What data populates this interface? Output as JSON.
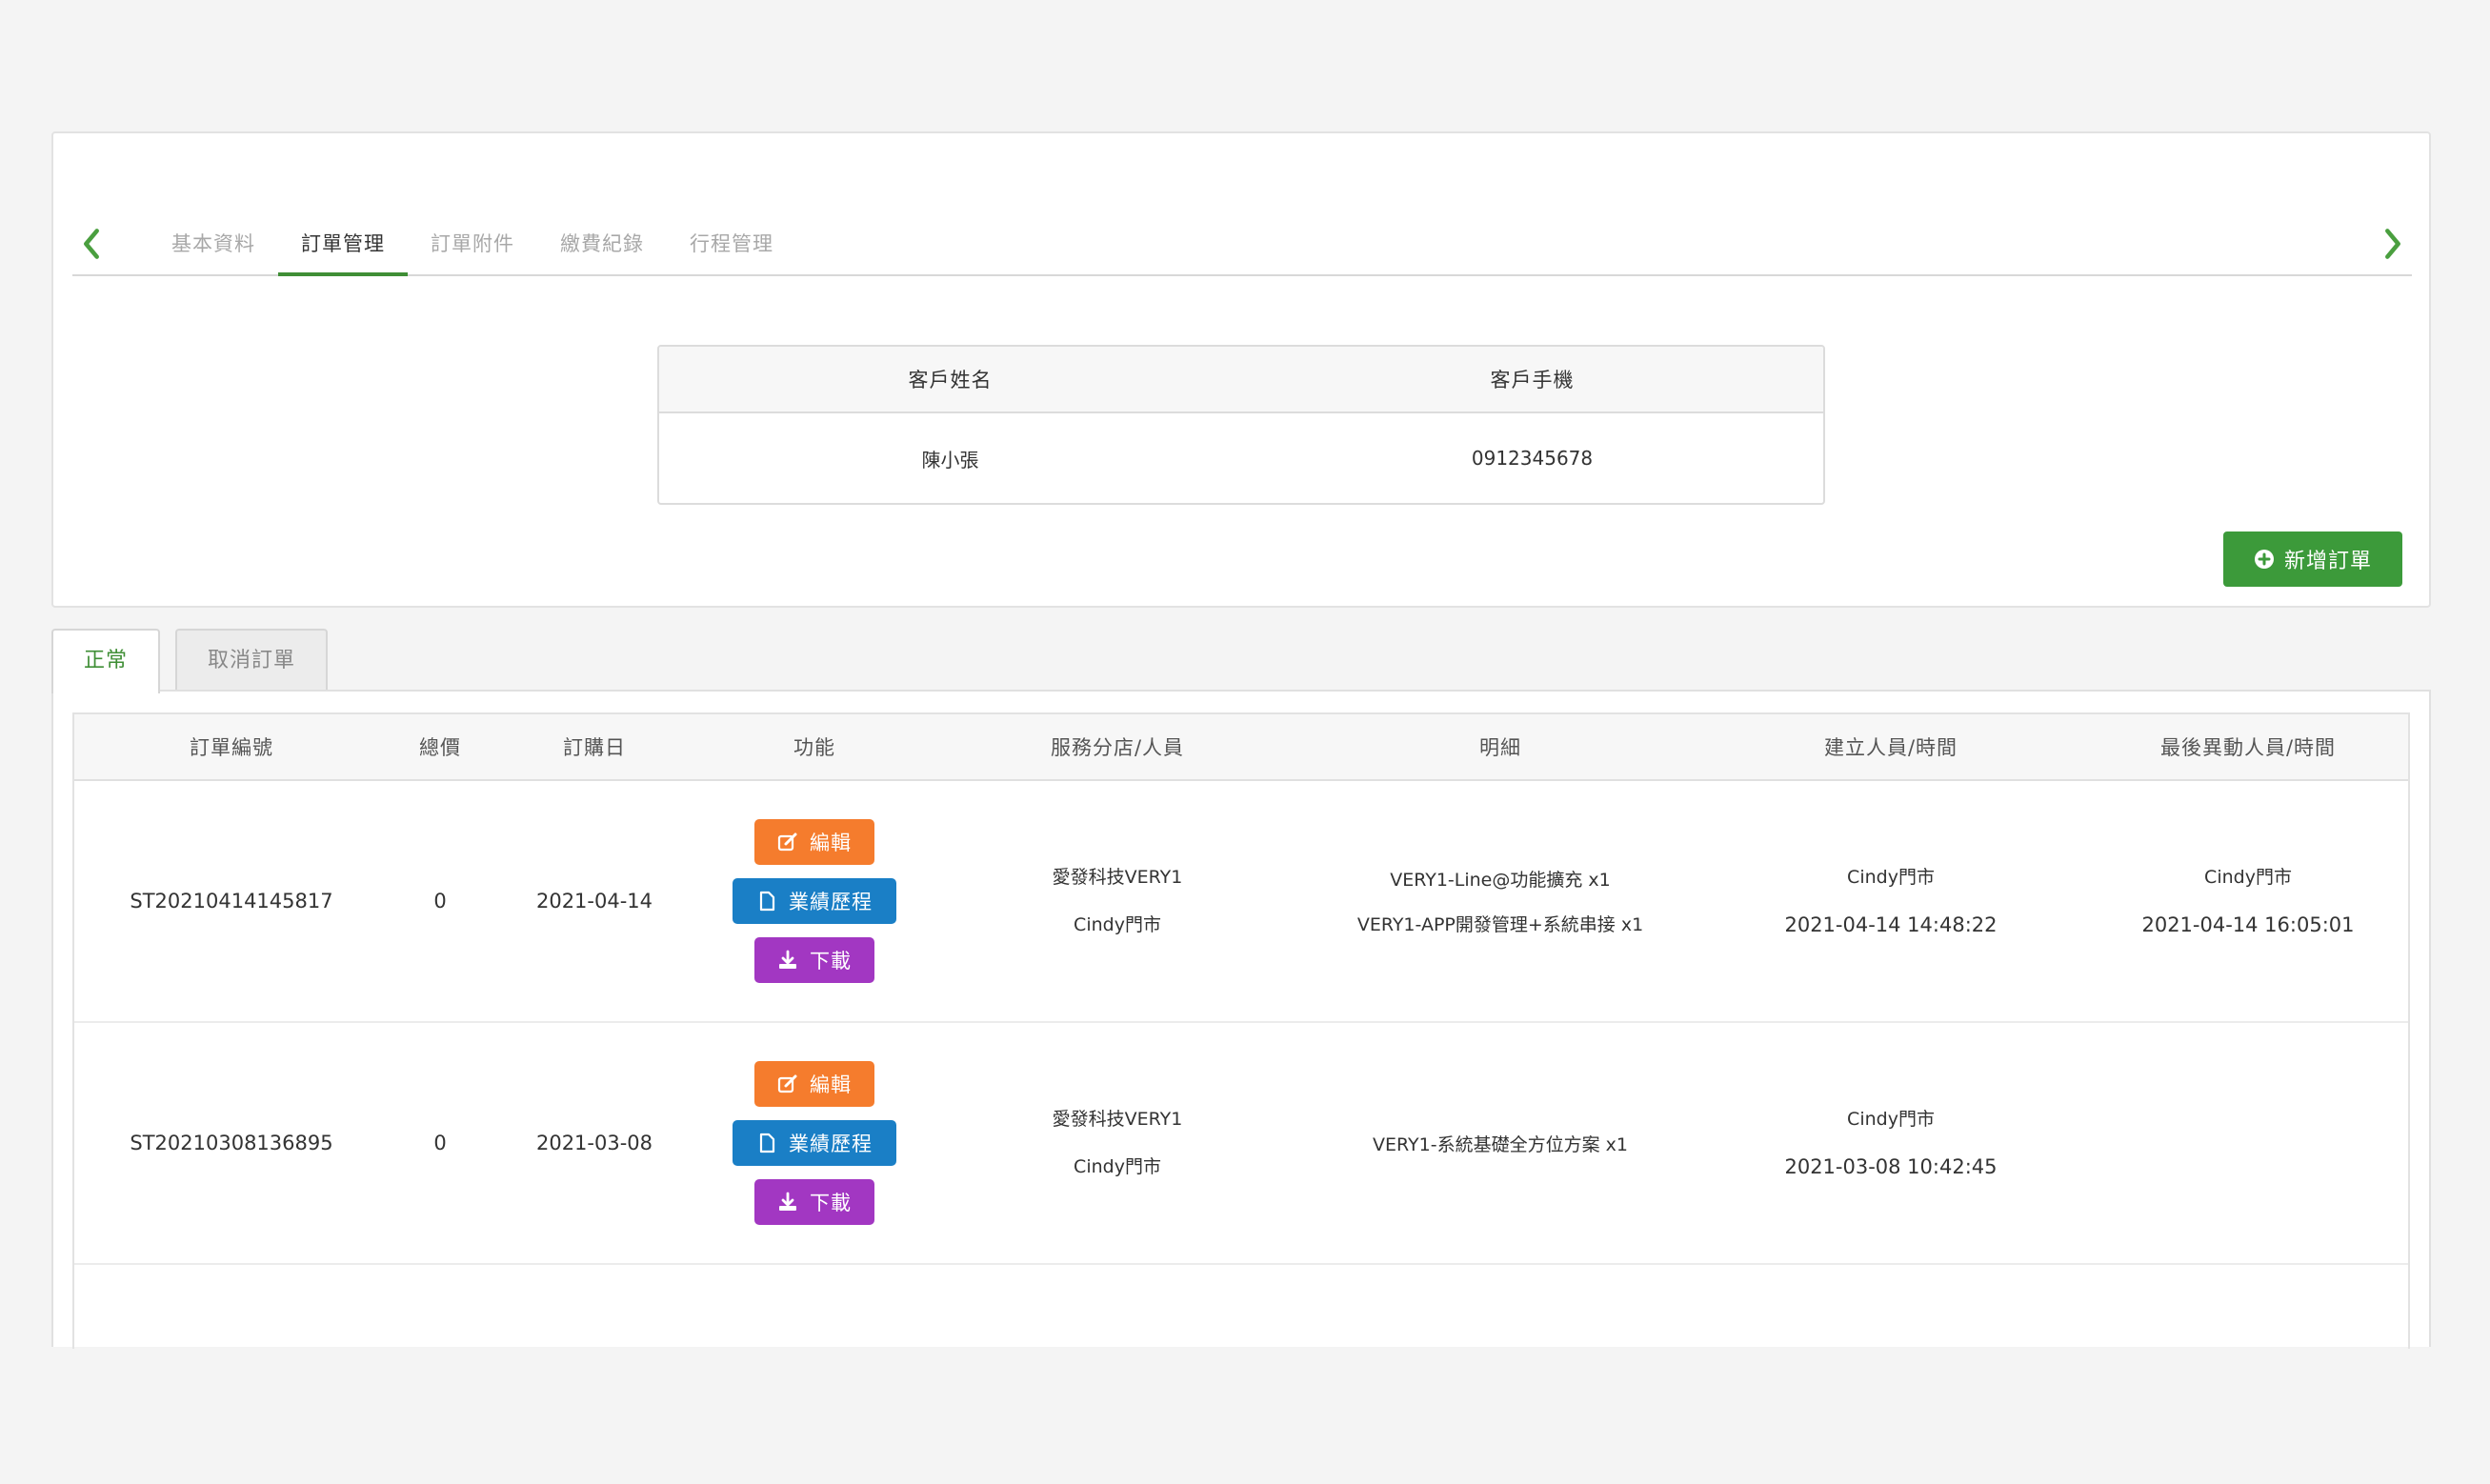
{
  "tabs": {
    "items": [
      "基本資料",
      "訂單管理",
      "訂單附件",
      "繳費紀錄",
      "行程管理"
    ],
    "active_index": 1
  },
  "customer": {
    "headers": [
      "客戶姓名",
      "客戶手機"
    ],
    "name": "陳小張",
    "phone": "0912345678"
  },
  "add_order_label": "新增訂單",
  "panel_tabs": {
    "normal": "正常",
    "cancelled": "取消訂單"
  },
  "orders": {
    "headers": [
      "訂單編號",
      "總價",
      "訂購日",
      "功能",
      "服務分店/人員",
      "明細",
      "建立人員/時間",
      "最後異動人員/時間"
    ],
    "buttons": {
      "edit": "編輯",
      "history": "業績歷程",
      "download": "下載"
    },
    "rows": [
      {
        "id": "ST20210414145817",
        "total": "0",
        "date": "2021-04-14",
        "branch": "愛發科技VERY1",
        "staff": "Cindy門市",
        "details": [
          "VERY1-Line@功能擴充 x1",
          "VERY1-APP開發管理+系統串接 x1"
        ],
        "created_by": "Cindy門市",
        "created_at": "2021-04-14 14:48:22",
        "modified_by": "Cindy門市",
        "modified_at": "2021-04-14 16:05:01"
      },
      {
        "id": "ST20210308136895",
        "total": "0",
        "date": "2021-03-08",
        "branch": "愛發科技VERY1",
        "staff": "Cindy門市",
        "details": [
          "VERY1-系統基礎全方位方案 x1"
        ],
        "created_by": "Cindy門市",
        "created_at": "2021-03-08 10:42:45",
        "modified_by": "",
        "modified_at": ""
      }
    ]
  },
  "colors": {
    "accent_green": "#3c9a3a",
    "edit_orange": "#f57c2d",
    "history_blue": "#1a7fc6",
    "download_purple": "#a237c2"
  }
}
